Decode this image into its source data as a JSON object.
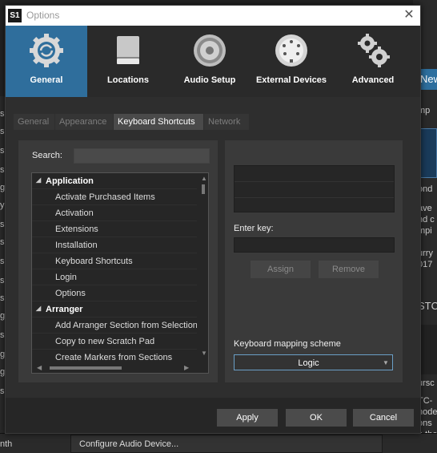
{
  "window": {
    "title": "Options",
    "app_icon": "S1"
  },
  "categories": [
    {
      "label": "General",
      "icon": "gear-refresh-icon",
      "active": true
    },
    {
      "label": "Locations",
      "icon": "drive-icon",
      "active": false
    },
    {
      "label": "Audio Setup",
      "icon": "speaker-icon",
      "active": false
    },
    {
      "label": "External Devices",
      "icon": "midi-connector-icon",
      "active": false
    },
    {
      "label": "Advanced",
      "icon": "gears-icon",
      "active": false
    }
  ],
  "subtabs": [
    {
      "label": "General",
      "active": false
    },
    {
      "label": "Appearance",
      "active": false
    },
    {
      "label": "Keyboard Shortcuts",
      "active": true
    },
    {
      "label": "Network",
      "active": false
    }
  ],
  "shortcuts": {
    "search_label": "Search:",
    "search_value": "",
    "tree": [
      {
        "label": "Application",
        "group": true
      },
      {
        "label": "Activate Purchased Items",
        "group": false
      },
      {
        "label": "Activation",
        "group": false
      },
      {
        "label": "Extensions",
        "group": false
      },
      {
        "label": "Installation",
        "group": false
      },
      {
        "label": "Keyboard Shortcuts",
        "group": false
      },
      {
        "label": "Login",
        "group": false
      },
      {
        "label": "Options",
        "group": false
      },
      {
        "label": "Arranger",
        "group": true
      },
      {
        "label": "Add Arranger Section from Selection",
        "group": false
      },
      {
        "label": "Copy to new Scratch Pad",
        "group": false
      },
      {
        "label": "Create Markers from Sections",
        "group": false
      }
    ],
    "enter_key_label": "Enter key:",
    "assign_label": "Assign",
    "remove_label": "Remove",
    "scheme_label": "Keyboard mapping scheme",
    "scheme_value": "Logic"
  },
  "footer": {
    "apply": "Apply",
    "ok": "OK",
    "cancel": "Cancel"
  },
  "background": {
    "bottom_left": "nth",
    "bottom_mid": "Configure Audio Device...",
    "right_news": "New",
    "right_lines": [
      "mp",
      "ond",
      "ave",
      "nd c",
      "mpi",
      "urry",
      "017",
      "STC",
      "ursc",
      "TC-",
      "node",
      "ons",
      "o the",
      "node"
    ],
    "left_lines": [
      "s",
      "s",
      "s",
      "s",
      "g",
      "y",
      "s",
      "s",
      "s",
      "s",
      "s",
      "g",
      "s",
      "g",
      "g",
      "s"
    ]
  },
  "colors": {
    "accent": "#2f6e9c",
    "window_bg": "#262626",
    "panel_bg": "#3a3a3a"
  }
}
